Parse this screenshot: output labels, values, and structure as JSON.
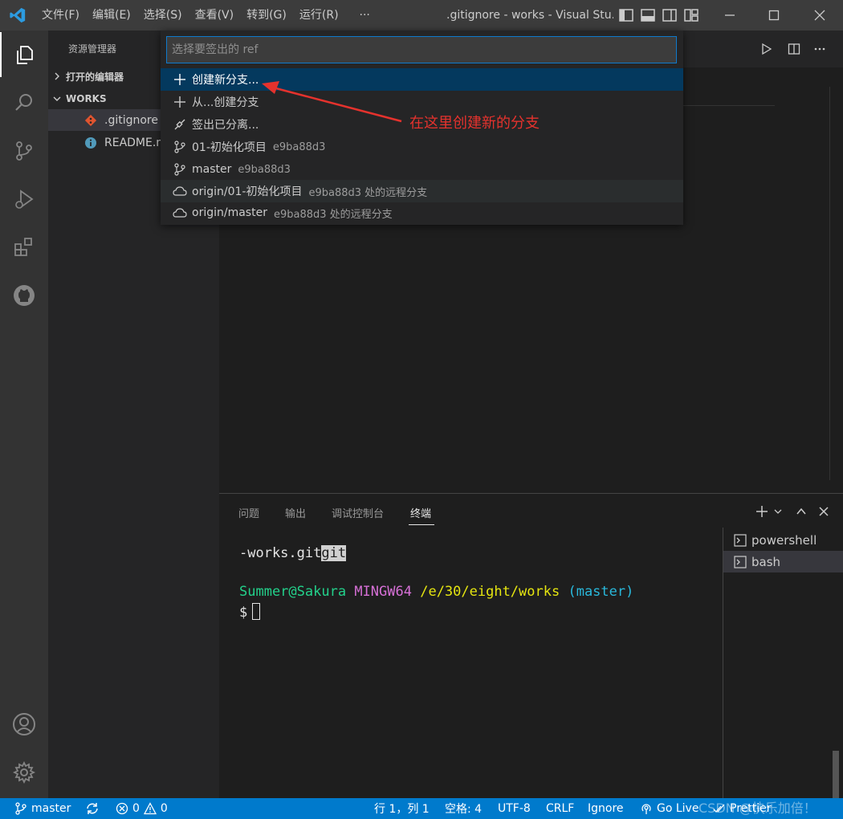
{
  "titlebar": {
    "menus": [
      "文件(F)",
      "编辑(E)",
      "选择(S)",
      "查看(V)",
      "转到(G)",
      "运行(R)",
      "···"
    ],
    "window_title": ".gitignore - works - Visual Stu..."
  },
  "sidebar": {
    "title": "资源管理器",
    "open_editors": "打开的编辑器",
    "workspace": "WORKS",
    "files": [
      {
        "name": ".gitignore",
        "icon": "git-icon"
      },
      {
        "name": "README.md",
        "icon": "info-icon"
      }
    ]
  },
  "quickpick": {
    "placeholder": "选择要签出的 ref",
    "items": [
      {
        "label": "创建新分支...",
        "desc": "",
        "icon": "plus-icon"
      },
      {
        "label": "从...创建分支",
        "desc": "",
        "icon": "plus-icon"
      },
      {
        "label": "签出已分离...",
        "desc": "",
        "icon": "debug-disconnect-icon"
      },
      {
        "label": "01-初始化项目",
        "desc": "e9ba88d3",
        "icon": "git-branch-icon"
      },
      {
        "label": "master",
        "desc": "e9ba88d3",
        "icon": "git-branch-icon"
      },
      {
        "label": "origin/01-初始化项目",
        "desc": "e9ba88d3 处的远程分支",
        "icon": "cloud-icon"
      },
      {
        "label": "origin/master",
        "desc": "e9ba88d3 处的远程分支",
        "icon": "cloud-icon"
      }
    ]
  },
  "annotation": {
    "text": "在这里创建新的分支",
    "color": "#e5322d"
  },
  "panel": {
    "tabs": [
      "问题",
      "输出",
      "调试控制台",
      "终端"
    ],
    "active_tab": "终端",
    "terminal": {
      "line1_prefix": "-works.git",
      "line1_highlight": "git",
      "prompt_user": "Summer@Sakura",
      "prompt_env": "MINGW64",
      "prompt_path": "/e/30/eight/works",
      "prompt_branch": "(master)",
      "prompt_symbol": "$"
    },
    "terminals": [
      "powershell",
      "bash"
    ]
  },
  "statusbar": {
    "branch": "master",
    "errors": "0",
    "warnings": "0",
    "position": "行 1，列 1",
    "spaces": "空格: 4",
    "encoding": "UTF-8",
    "eol": "CRLF",
    "ignore": "Ignore",
    "golive": "Go Live",
    "prettier": "Prettier"
  },
  "watermark": "CSDN @快乐加倍！",
  "colors": {
    "accent": "#007acc",
    "selection": "#04395e",
    "activitybar": "#333333",
    "sidebar": "#252526",
    "editor": "#1e1e1e"
  }
}
